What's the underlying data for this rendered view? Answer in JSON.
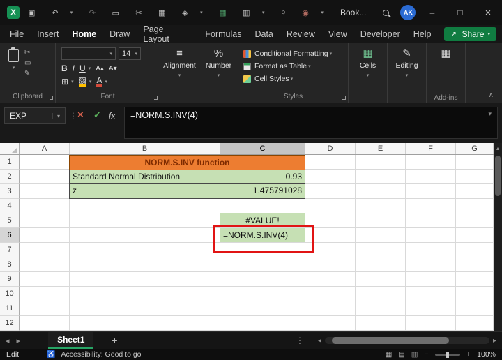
{
  "colors": {
    "accent_green": "#107C41",
    "title_fill_orange": "#ED7D31",
    "title_text_maroon": "#7F2B00",
    "cell_green": "#C6E0B4",
    "annotation_red": "#E11414",
    "avatar_blue": "#2B6BD3"
  },
  "titlebar": {
    "logo": "X",
    "title": "Book...",
    "avatar": "AK"
  },
  "window": {
    "minimize": "–",
    "maximize": "□",
    "close": "×"
  },
  "menubar": {
    "items": [
      "File",
      "Insert",
      "Home",
      "Draw",
      "Page Layout",
      "Formulas",
      "Data",
      "Review",
      "View",
      "Developer",
      "Help"
    ],
    "share": "Share"
  },
  "ribbon": {
    "clipboard_group": "Clipboard",
    "font_group": "Font",
    "styles_group": "Styles",
    "addins_group": "Add-ins",
    "font_size": "14",
    "bold": "B",
    "italic": "I",
    "underline": "U",
    "alignment": "Alignment",
    "number": "Number",
    "conditional_formatting": "Conditional Formatting",
    "format_as_table": "Format as Table",
    "cell_styles": "Cell Styles",
    "cells": "Cells",
    "editing": "Editing",
    "addins": "Add-ins"
  },
  "formula_bar": {
    "name_box": "EXP",
    "fx": "fx",
    "formula": "=NORM.S.INV(4)"
  },
  "grid": {
    "columns": [
      "A",
      "B",
      "C",
      "D",
      "E",
      "F",
      "G"
    ],
    "rows": [
      "1",
      "2",
      "3",
      "4",
      "5",
      "6",
      "7",
      "8",
      "9",
      "10",
      "11",
      "12"
    ],
    "selected_column": "C",
    "cells": {
      "b1c1": "NORM.S.INV function",
      "b2": "Standard Normal Distribution",
      "c2": "0.93",
      "b3": "z",
      "c3": "1.475791028",
      "c5": "#VALUE!",
      "c6": "=NORM.S.INV(4)"
    }
  },
  "sheet_bar": {
    "tab": "Sheet1",
    "add_sheet": "+"
  },
  "status_bar": {
    "mode": "Edit",
    "accessibility": "Accessibility: Good to go",
    "zoom": "100%"
  },
  "icons": {
    "caret_down": "▾",
    "save": "▣",
    "undo": "↶",
    "redo": "↷",
    "copy": "▭",
    "cut": "✂",
    "picture": "▦",
    "paint": "◈",
    "chart": "▥",
    "table": "▦",
    "person": "○",
    "record": "◉",
    "dots_vertical": "⋮",
    "cancel": "×",
    "check": "✓",
    "align": "≡",
    "percent": "%",
    "borders": "⊞",
    "font_increase": "A▴",
    "font_decrease": "A▾",
    "fill_color": "▨",
    "font_color": "A",
    "grid": "▦",
    "pencil": "✎",
    "left": "◂",
    "right": "▸",
    "up": "▴",
    "collapse": "∧",
    "accessibility": "♿",
    "view_normal": "▦",
    "view_layout": "▤",
    "view_break": "▥",
    "minus": "−",
    "plus": "+",
    "share_arrow": "↗"
  }
}
